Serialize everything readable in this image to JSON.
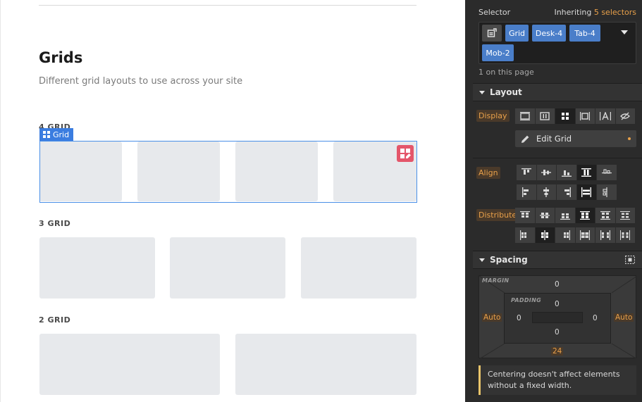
{
  "canvas": {
    "heading": "Grids",
    "subheading": "Different grid layouts to use across your site",
    "sections": {
      "four": "4 GRID",
      "three": "3 GRID",
      "two": "2 GRID"
    },
    "selection_tag": "Grid"
  },
  "panel": {
    "selector_title": "Selector",
    "inheriting_prefix": "Inheriting ",
    "inheriting_count": "5 selectors",
    "chips": [
      "Grid",
      "Desk-4",
      "Tab-4",
      "Mob-2"
    ],
    "on_page": "1 on this page",
    "layout": {
      "title": "Layout",
      "display_label": "Display",
      "edit_grid_label": "Edit Grid",
      "align_label": "Align",
      "distribute_label": "Distribute"
    },
    "spacing": {
      "title": "Spacing",
      "margin_label": "MARGIN",
      "padding_label": "PADDING",
      "margin_top": "0",
      "margin_left": "Auto",
      "margin_right": "Auto",
      "margin_bottom": "24",
      "padding_top": "0",
      "padding_left": "0",
      "padding_right": "0",
      "padding_bottom": "0"
    },
    "notice": "Centering doesn't affect elements without a fixed width."
  },
  "colors": {
    "accent": "#3b7de0",
    "chip": "#4a7ec9",
    "warning": "#e8a04a",
    "edit_badge": "#e4566a",
    "panel_bg": "#2b2b2b"
  }
}
